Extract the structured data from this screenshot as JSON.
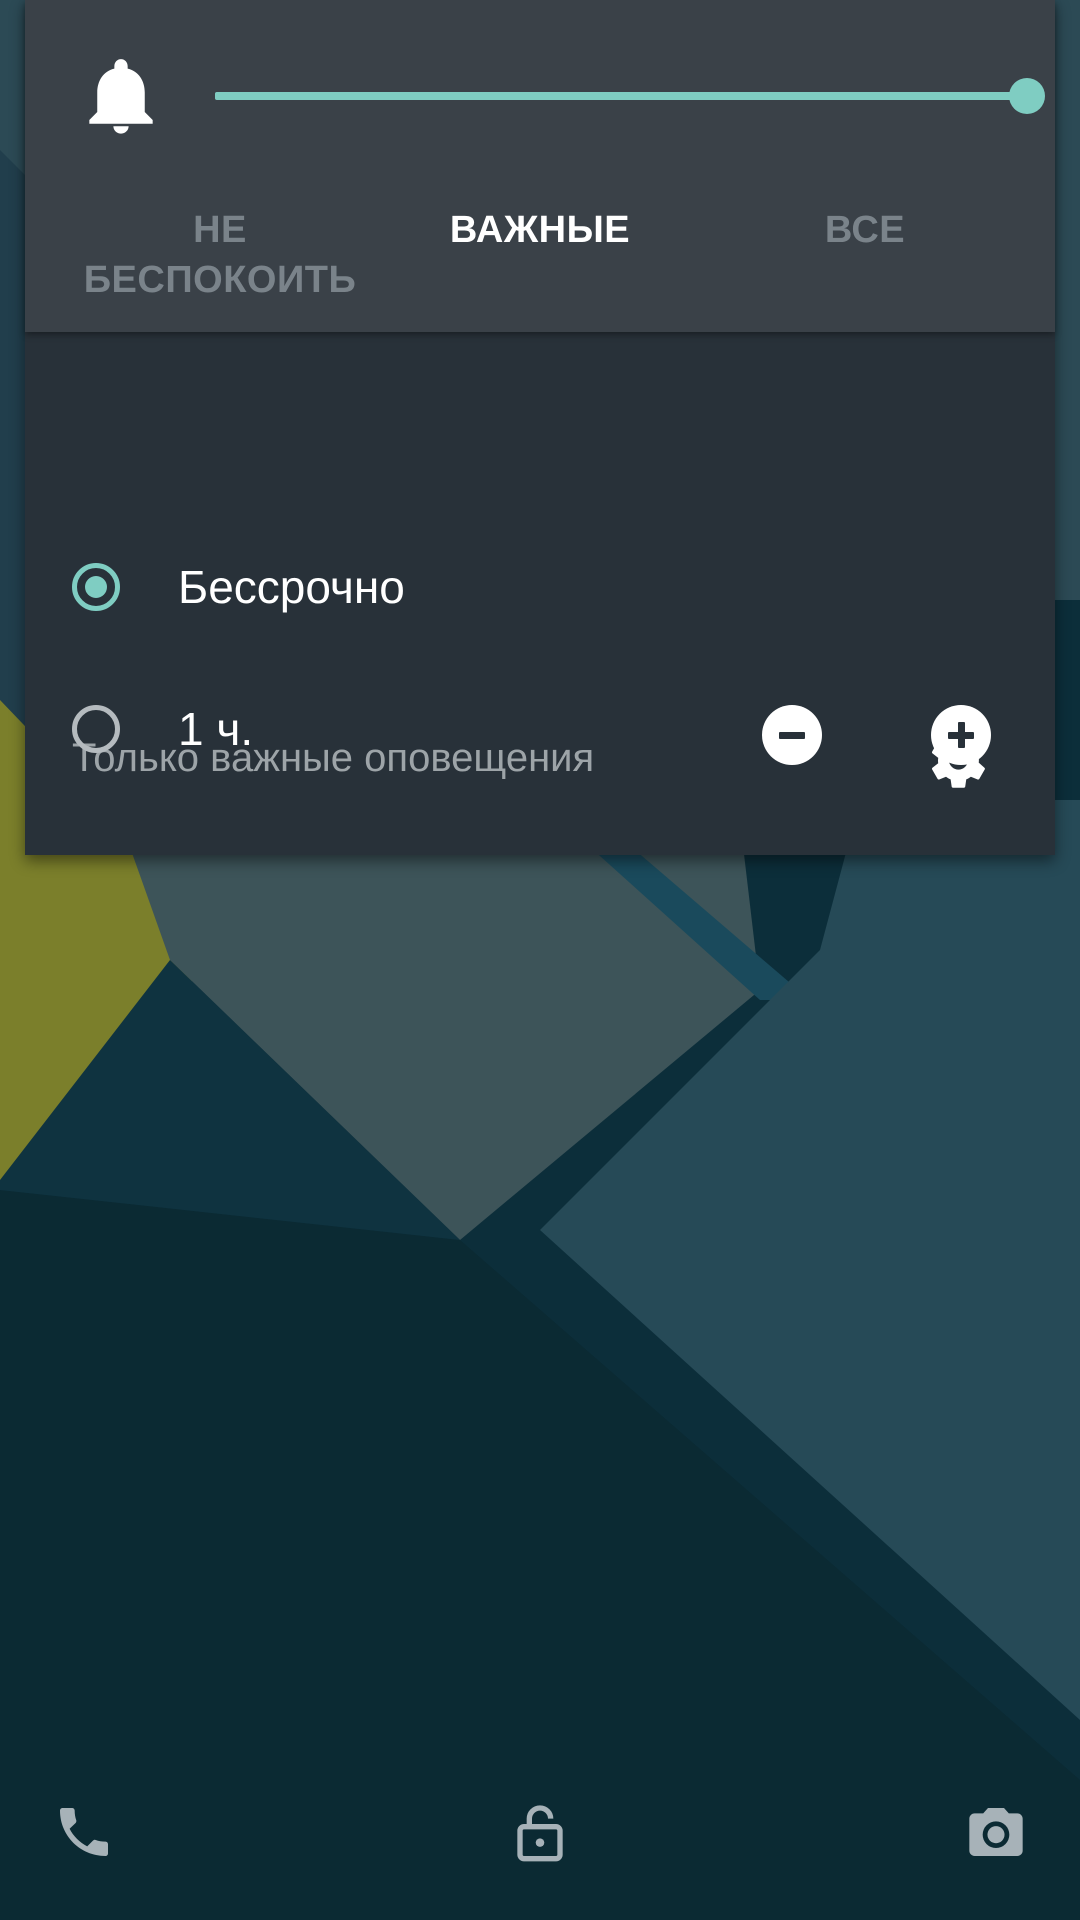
{
  "volume_panel": {
    "stream_icon": "bell-icon",
    "volume_level": 1.0,
    "accent_color": "#7fcdc2"
  },
  "modes": {
    "tabs": [
      {
        "label": "НЕ\nБЕСПОКОИТЬ",
        "selected": false
      },
      {
        "label": "ВАЖНЫЕ",
        "selected": true
      },
      {
        "label": "ВСЕ",
        "selected": false
      }
    ]
  },
  "important": {
    "title": "Только важные оповещения",
    "settings_icon": "gear-icon",
    "options": [
      {
        "label": "Бессрочно",
        "checked": true
      },
      {
        "label": "1 ч.",
        "checked": false
      }
    ],
    "decrease_icon": "minus-circle-icon",
    "increase_icon": "plus-circle-icon"
  },
  "lockscreen": {
    "left_icon": "phone-icon",
    "center_icon": "lock-open-icon",
    "right_icon": "camera-icon"
  }
}
